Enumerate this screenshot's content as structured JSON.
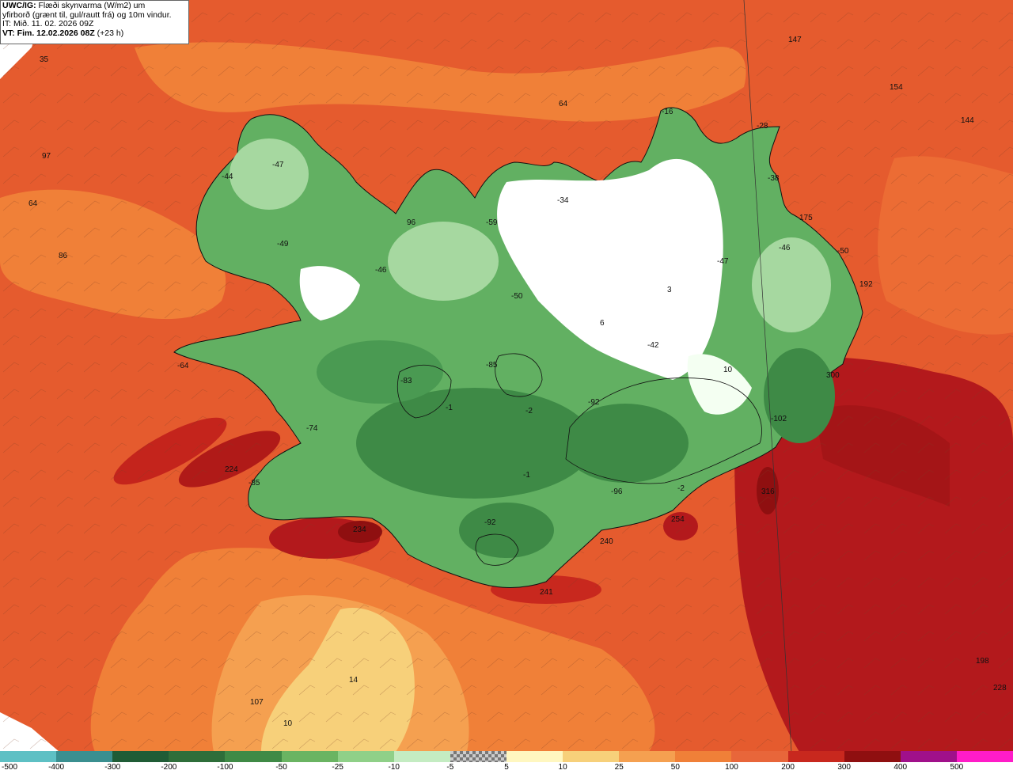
{
  "header": {
    "model_prefix": "UWC/IG:",
    "title_line1": " Flæði skynvarma (W/m2) um",
    "title_line2": "yfirborð (grænt til, gul/rautt frá) og 10m vindur.",
    "it_line": "IT: Mið. 11. 02. 2026 09Z",
    "vt_prefix": "VT: Fim. 12.02.2026 08Z",
    "vt_suffix": " (+23 h)"
  },
  "colors": {
    "sea_base": "#e55b2e",
    "deep_red": "#b3191c",
    "dark_red": "#8f0f10",
    "orange": "#f08038",
    "light_orange": "#f5a050",
    "yellow": "#f7d07a",
    "land_green": "#62b062",
    "dark_green": "#3e8a46",
    "light_green": "#a6d8a0",
    "white": "#ffffff"
  },
  "map_values": [
    {
      "t": "147"
    },
    {
      "t": "154"
    },
    {
      "t": "144"
    },
    {
      "t": "35"
    },
    {
      "t": "97"
    },
    {
      "t": "64"
    },
    {
      "t": "86"
    },
    {
      "t": "64"
    },
    {
      "t": "-16"
    },
    {
      "t": "-28"
    },
    {
      "t": "-38"
    },
    {
      "t": "-44"
    },
    {
      "t": "-47"
    },
    {
      "t": "-34"
    },
    {
      "t": "96"
    },
    {
      "t": "-59"
    },
    {
      "t": "175"
    },
    {
      "t": "-46"
    },
    {
      "t": "-50"
    },
    {
      "t": "-49"
    },
    {
      "t": "-46"
    },
    {
      "t": "-47"
    },
    {
      "t": "192"
    },
    {
      "t": "-50"
    },
    {
      "t": "3"
    },
    {
      "t": "6"
    },
    {
      "t": "-42"
    },
    {
      "t": "10"
    },
    {
      "t": "-64"
    },
    {
      "t": "-85"
    },
    {
      "t": "-83"
    },
    {
      "t": "300"
    },
    {
      "t": "-1"
    },
    {
      "t": "-2"
    },
    {
      "t": "-92"
    },
    {
      "t": "-102"
    },
    {
      "t": "-74"
    },
    {
      "t": "224"
    },
    {
      "t": "-85"
    },
    {
      "t": "-1"
    },
    {
      "t": "-96"
    },
    {
      "t": "-2"
    },
    {
      "t": "316"
    },
    {
      "t": "-92"
    },
    {
      "t": "234"
    },
    {
      "t": "240"
    },
    {
      "t": "254"
    },
    {
      "t": "241"
    },
    {
      "t": "198"
    },
    {
      "t": "228"
    },
    {
      "t": "14"
    },
    {
      "t": "107"
    },
    {
      "t": "10"
    }
  ],
  "legend": {
    "segments": [
      {
        "c": "#5ec0c4"
      },
      {
        "c": "#3a8f90"
      },
      {
        "c": "#1f5c36"
      },
      {
        "c": "#2e6e3a"
      },
      {
        "c": "#3f8a46"
      },
      {
        "c": "#6ab462"
      },
      {
        "c": "#8fd088"
      },
      {
        "c": "#c4ecc2"
      },
      {
        "c": "checker"
      },
      {
        "c": "#fff7c0"
      },
      {
        "c": "#f7d07a"
      },
      {
        "c": "#f5a050"
      },
      {
        "c": "#f08038"
      },
      {
        "c": "#e8663a"
      },
      {
        "c": "#c8281e"
      },
      {
        "c": "#8f0f10"
      },
      {
        "c": "#a0108a"
      },
      {
        "c": "#ff1cc8"
      }
    ],
    "ticks": [
      "-500",
      "-400",
      "-300",
      "-200",
      "-100",
      "-50",
      "-25",
      "-10",
      "-5",
      "5",
      "10",
      "25",
      "50",
      "100",
      "200",
      "300",
      "400",
      "500"
    ]
  }
}
